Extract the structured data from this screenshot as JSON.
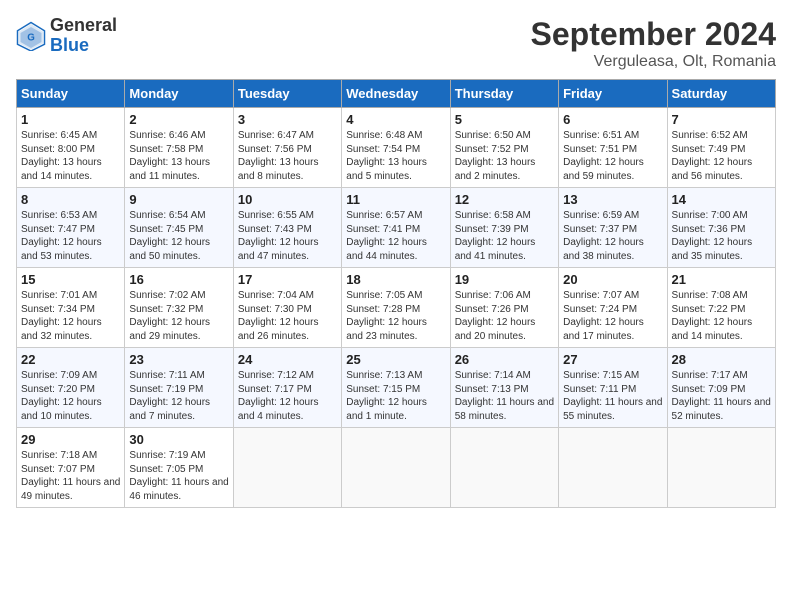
{
  "header": {
    "logo": {
      "general": "General",
      "blue": "Blue"
    },
    "title": "September 2024",
    "subtitle": "Verguleasa, Olt, Romania"
  },
  "weekdays": [
    "Sunday",
    "Monday",
    "Tuesday",
    "Wednesday",
    "Thursday",
    "Friday",
    "Saturday"
  ],
  "weeks": [
    [
      {
        "day": "1",
        "info": "Sunrise: 6:45 AM\nSunset: 8:00 PM\nDaylight: 13 hours and 14 minutes."
      },
      {
        "day": "2",
        "info": "Sunrise: 6:46 AM\nSunset: 7:58 PM\nDaylight: 13 hours and 11 minutes."
      },
      {
        "day": "3",
        "info": "Sunrise: 6:47 AM\nSunset: 7:56 PM\nDaylight: 13 hours and 8 minutes."
      },
      {
        "day": "4",
        "info": "Sunrise: 6:48 AM\nSunset: 7:54 PM\nDaylight: 13 hours and 5 minutes."
      },
      {
        "day": "5",
        "info": "Sunrise: 6:50 AM\nSunset: 7:52 PM\nDaylight: 13 hours and 2 minutes."
      },
      {
        "day": "6",
        "info": "Sunrise: 6:51 AM\nSunset: 7:51 PM\nDaylight: 12 hours and 59 minutes."
      },
      {
        "day": "7",
        "info": "Sunrise: 6:52 AM\nSunset: 7:49 PM\nDaylight: 12 hours and 56 minutes."
      }
    ],
    [
      {
        "day": "8",
        "info": "Sunrise: 6:53 AM\nSunset: 7:47 PM\nDaylight: 12 hours and 53 minutes."
      },
      {
        "day": "9",
        "info": "Sunrise: 6:54 AM\nSunset: 7:45 PM\nDaylight: 12 hours and 50 minutes."
      },
      {
        "day": "10",
        "info": "Sunrise: 6:55 AM\nSunset: 7:43 PM\nDaylight: 12 hours and 47 minutes."
      },
      {
        "day": "11",
        "info": "Sunrise: 6:57 AM\nSunset: 7:41 PM\nDaylight: 12 hours and 44 minutes."
      },
      {
        "day": "12",
        "info": "Sunrise: 6:58 AM\nSunset: 7:39 PM\nDaylight: 12 hours and 41 minutes."
      },
      {
        "day": "13",
        "info": "Sunrise: 6:59 AM\nSunset: 7:37 PM\nDaylight: 12 hours and 38 minutes."
      },
      {
        "day": "14",
        "info": "Sunrise: 7:00 AM\nSunset: 7:36 PM\nDaylight: 12 hours and 35 minutes."
      }
    ],
    [
      {
        "day": "15",
        "info": "Sunrise: 7:01 AM\nSunset: 7:34 PM\nDaylight: 12 hours and 32 minutes."
      },
      {
        "day": "16",
        "info": "Sunrise: 7:02 AM\nSunset: 7:32 PM\nDaylight: 12 hours and 29 minutes."
      },
      {
        "day": "17",
        "info": "Sunrise: 7:04 AM\nSunset: 7:30 PM\nDaylight: 12 hours and 26 minutes."
      },
      {
        "day": "18",
        "info": "Sunrise: 7:05 AM\nSunset: 7:28 PM\nDaylight: 12 hours and 23 minutes."
      },
      {
        "day": "19",
        "info": "Sunrise: 7:06 AM\nSunset: 7:26 PM\nDaylight: 12 hours and 20 minutes."
      },
      {
        "day": "20",
        "info": "Sunrise: 7:07 AM\nSunset: 7:24 PM\nDaylight: 12 hours and 17 minutes."
      },
      {
        "day": "21",
        "info": "Sunrise: 7:08 AM\nSunset: 7:22 PM\nDaylight: 12 hours and 14 minutes."
      }
    ],
    [
      {
        "day": "22",
        "info": "Sunrise: 7:09 AM\nSunset: 7:20 PM\nDaylight: 12 hours and 10 minutes."
      },
      {
        "day": "23",
        "info": "Sunrise: 7:11 AM\nSunset: 7:19 PM\nDaylight: 12 hours and 7 minutes."
      },
      {
        "day": "24",
        "info": "Sunrise: 7:12 AM\nSunset: 7:17 PM\nDaylight: 12 hours and 4 minutes."
      },
      {
        "day": "25",
        "info": "Sunrise: 7:13 AM\nSunset: 7:15 PM\nDaylight: 12 hours and 1 minute."
      },
      {
        "day": "26",
        "info": "Sunrise: 7:14 AM\nSunset: 7:13 PM\nDaylight: 11 hours and 58 minutes."
      },
      {
        "day": "27",
        "info": "Sunrise: 7:15 AM\nSunset: 7:11 PM\nDaylight: 11 hours and 55 minutes."
      },
      {
        "day": "28",
        "info": "Sunrise: 7:17 AM\nSunset: 7:09 PM\nDaylight: 11 hours and 52 minutes."
      }
    ],
    [
      {
        "day": "29",
        "info": "Sunrise: 7:18 AM\nSunset: 7:07 PM\nDaylight: 11 hours and 49 minutes."
      },
      {
        "day": "30",
        "info": "Sunrise: 7:19 AM\nSunset: 7:05 PM\nDaylight: 11 hours and 46 minutes."
      },
      null,
      null,
      null,
      null,
      null
    ]
  ]
}
